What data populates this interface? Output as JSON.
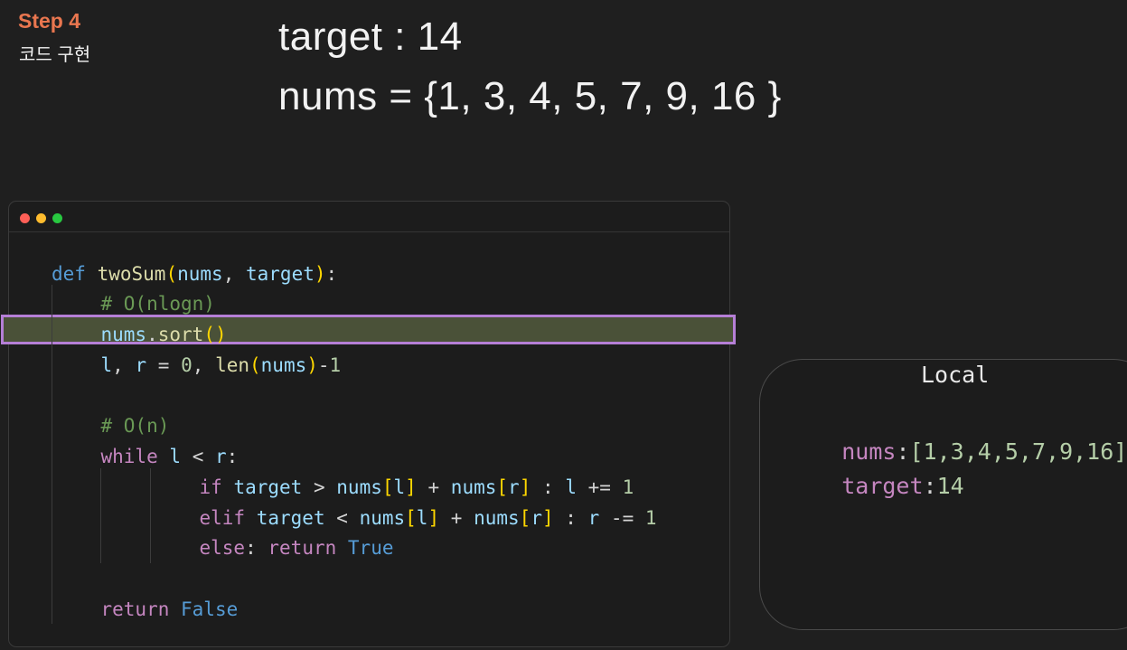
{
  "header": {
    "step": "Step 4",
    "subtitle": "코드 구현",
    "line1": "target : 14",
    "line2": "nums = {1, 3, 4, 5, 7, 9, 16 }"
  },
  "colors": {
    "accent": "#e9764f",
    "highlight_border": "#b57fd6",
    "highlight_fill": "#4a5138"
  },
  "code": {
    "highlighted_line": 3,
    "lines": [
      "def twoSum(nums, target):",
      "# O(nlogn)",
      "nums.sort()",
      "l, r = 0, len(nums)-1",
      "",
      "# O(n)",
      "while l < r:",
      "if target > nums[l] + nums[r] : l += 1",
      "elif target < nums[l] + nums[r] : r -= 1",
      "else: return True",
      "",
      "return False"
    ]
  },
  "local": {
    "title": "Local",
    "vars": [
      {
        "name": "nums",
        "value": "[1,3,4,5,7,9,16]"
      },
      {
        "name": "target",
        "value": "14"
      }
    ]
  }
}
